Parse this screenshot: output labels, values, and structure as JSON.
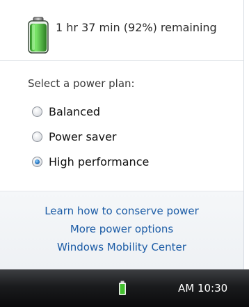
{
  "battery": {
    "status_text": "1 hr 37 min (92%) remaining",
    "charge_fraction": 0.92,
    "icon": "battery-icon",
    "fill_color": "#4cc33b"
  },
  "power_plan": {
    "prompt": "Select a power plan:",
    "options": [
      {
        "label": "Balanced",
        "selected": false
      },
      {
        "label": "Power saver",
        "selected": false
      },
      {
        "label": "High performance",
        "selected": true
      }
    ]
  },
  "links": {
    "conserve": "Learn how to conserve power",
    "more_options": "More power options",
    "mobility_center": "Windows Mobility Center",
    "color": "#1c5ca6"
  },
  "taskbar": {
    "clock": "AM 10:30",
    "tray_icon": "battery-tray-icon"
  }
}
